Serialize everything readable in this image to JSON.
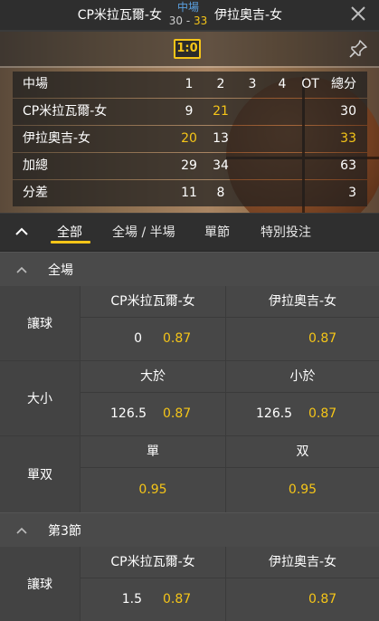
{
  "header": {
    "home_team": "CP米拉瓦爾-女",
    "away_team": "伊拉奧吉-女",
    "period": "中場",
    "home_score": "30",
    "separator": "-",
    "away_score": "33"
  },
  "board": {
    "score_badge": "1:0",
    "columns": [
      "中場",
      "1",
      "2",
      "3",
      "4",
      "OT",
      "總分"
    ],
    "rows": [
      {
        "name": "CP米拉瓦爾-女",
        "q1": "9",
        "q2": "21",
        "q3": "",
        "q4": "",
        "ot": "",
        "total": "30"
      },
      {
        "name": "伊拉奧吉-女",
        "q1": "20",
        "q2": "13",
        "q3": "",
        "q4": "",
        "ot": "",
        "total": "33"
      },
      {
        "name": "加總",
        "q1": "29",
        "q2": "34",
        "q3": "",
        "q4": "",
        "ot": "",
        "total": "63"
      },
      {
        "name": "分差",
        "q1": "11",
        "q2": "8",
        "q3": "",
        "q4": "",
        "ot": "",
        "total": "3"
      }
    ]
  },
  "tabs": [
    {
      "label": "全部",
      "active": true
    },
    {
      "label": "全場 / 半場",
      "active": false
    },
    {
      "label": "單節",
      "active": false
    },
    {
      "label": "特別投注",
      "active": false
    }
  ],
  "sections": [
    {
      "title": "全場",
      "markets": [
        {
          "label": "讓球",
          "home_header": "CP米拉瓦爾-女",
          "away_header": "伊拉奧吉-女",
          "home_line": "0",
          "home_odds": "0.87",
          "away_line": "",
          "away_odds": "0.87"
        },
        {
          "label": "大小",
          "home_header": "大於",
          "away_header": "小於",
          "home_line": "126.5",
          "home_odds": "0.87",
          "away_line": "126.5",
          "away_odds": "0.87"
        },
        {
          "label": "單双",
          "home_header": "單",
          "away_header": "双",
          "home_line": "",
          "home_odds": "0.95",
          "away_line": "",
          "away_odds": "0.95"
        }
      ]
    },
    {
      "title": "第3節",
      "markets": [
        {
          "label": "讓球",
          "home_header": "CP米拉瓦爾-女",
          "away_header": "伊拉奧吉-女",
          "home_line": "1.5",
          "home_odds": "0.87",
          "away_line": "",
          "away_odds": "0.87"
        }
      ]
    }
  ],
  "icons": {
    "close": "close-icon",
    "pin": "pin-icon",
    "collapse": "chevron-up-icon"
  },
  "colors": {
    "accent": "#f5c518",
    "period": "#5aa0e0",
    "background": "#3b3b3b"
  }
}
